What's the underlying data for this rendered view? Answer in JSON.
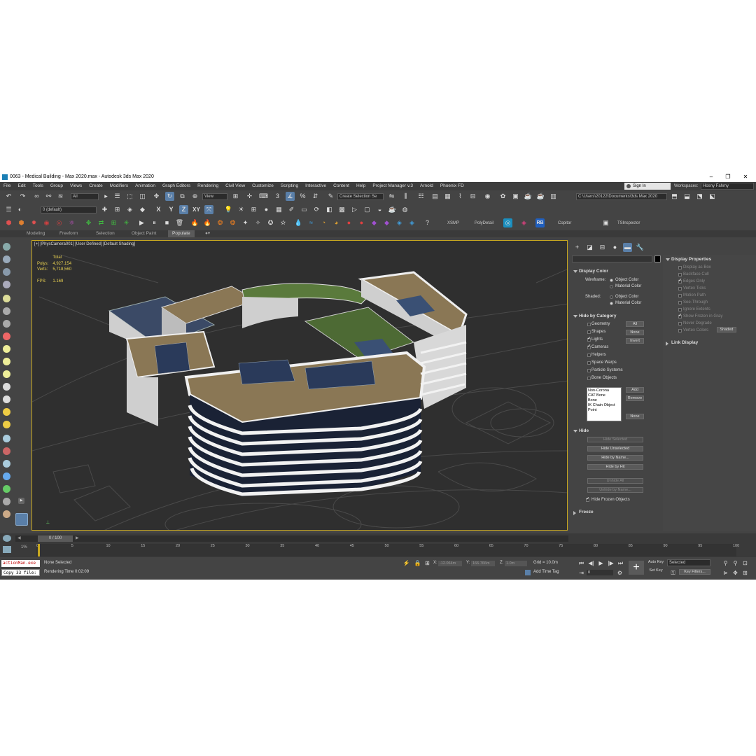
{
  "window": {
    "title": "0063 - Medical Building - Max 2020.max - Autodesk 3ds Max 2020",
    "minimize": "–",
    "maximize": "❐",
    "close": "✕"
  },
  "menu": [
    "File",
    "Edit",
    "Tools",
    "Group",
    "Views",
    "Create",
    "Modifiers",
    "Animation",
    "Graph Editors",
    "Rendering",
    "Civil View",
    "Customize",
    "Scripting",
    "Interactive",
    "Content",
    "Help",
    "Project Manager v.3",
    "Arnold",
    "Phoenix FD"
  ],
  "account": {
    "sign_in": "Sign In",
    "workspaces_label": "Workspaces:",
    "workspace": "Hosny Fahmy"
  },
  "toolbar": {
    "filter": "All",
    "ref_coord": "View",
    "selection_set": "Create Selection Se",
    "path": "C:\\Users\\20122\\Documents\\3ds Max 2020",
    "layer": "0 (default)",
    "xsmp": "XSMP",
    "polydetail": "PolyDetail",
    "copitor": "Copitor",
    "tsinspector": "TSInspector",
    "rb": "RB",
    "axis_x": "X",
    "axis_y": "Y",
    "axis_z": "Z",
    "axis_xy": "XY"
  },
  "ribbon": [
    "Modeling",
    "Freeform",
    "Selection",
    "Object Paint",
    "Populate"
  ],
  "viewport": {
    "label": "[+] [PhysCamera001] [User Defined] [Default Shading]",
    "stats_total": "Total",
    "polys_label": "Polys:",
    "polys": "4,927,154",
    "verts_label": "Verts:",
    "verts": "5,718,560",
    "fps_label": "FPS:",
    "fps": "1.169"
  },
  "command_panel": {
    "display_color": {
      "title": "Display Color",
      "wireframe_label": "Wireframe:",
      "shaded_label": "Shaded:",
      "object_color": "Object Color",
      "material_color": "Material Color"
    },
    "hide_by_category": {
      "title": "Hide by Category",
      "items": [
        {
          "label": "Geometry",
          "checked": false
        },
        {
          "label": "Shapes",
          "checked": false
        },
        {
          "label": "Lights",
          "checked": true
        },
        {
          "label": "Cameras",
          "checked": true
        },
        {
          "label": "Helpers",
          "checked": false
        },
        {
          "label": "Space Warps",
          "checked": false
        },
        {
          "label": "Particle Systems",
          "checked": false
        },
        {
          "label": "Bone Objects",
          "checked": false
        }
      ],
      "btn_all": "All",
      "btn_none": "None",
      "btn_invert": "Invert",
      "list": [
        "Non-Corona",
        "CAT Bone",
        "Bone",
        "IK Chain Object",
        "Point"
      ],
      "btn_add": "Add",
      "btn_remove": "Remove",
      "btn_none2": "None"
    },
    "hide": {
      "title": "Hide",
      "buttons": [
        "Hide Selected",
        "Hide Unselected",
        "Hide by Name...",
        "Hide by Hit",
        "Unhide All",
        "Unhide by Name..."
      ],
      "hide_frozen": "Hide Frozen Objects"
    },
    "freeze": {
      "title": "Freeze"
    }
  },
  "display_properties": {
    "title": "Display Properties",
    "items": [
      {
        "label": "Display as Box",
        "checked": false
      },
      {
        "label": "Backface Cull",
        "checked": false
      },
      {
        "label": "Edges Only",
        "checked": true
      },
      {
        "label": "Vertex Ticks",
        "checked": false
      },
      {
        "label": "Motion Path",
        "checked": false
      },
      {
        "label": "See-Through",
        "checked": false
      },
      {
        "label": "Ignore Extents",
        "checked": false
      },
      {
        "label": "Show Frozen in Gray",
        "checked": true
      },
      {
        "label": "Never Degrade",
        "checked": false
      },
      {
        "label": "Vertex Colors",
        "checked": false
      }
    ],
    "shaded_btn": "Shaded",
    "link_display": "Link Display"
  },
  "timeline": {
    "frame": "0 / 100",
    "ticks": [
      "0",
      "5",
      "10",
      "15",
      "20",
      "25",
      "30",
      "35",
      "40",
      "45",
      "50",
      "55",
      "60",
      "65",
      "70",
      "75",
      "80",
      "85",
      "90",
      "95",
      "100"
    ]
  },
  "status": {
    "maxscript_1": "actionMan.exe",
    "maxscript_2": "Copy 33 file:",
    "selection": "None Selected",
    "render_time": "Rendering Time  0:02:09",
    "x_label": "X:",
    "x": "-12.064m",
    "y_label": "Y:",
    "y": "166.766m",
    "z_label": "Z:",
    "z": "1.0m",
    "grid": "Grid = 10.0m",
    "add_time_tag": "Add Time Tag",
    "auto_key": "Auto Key",
    "set_key": "Set Key",
    "selected": "Selected",
    "key_filters": "Key Filters...",
    "frame_field": "0"
  }
}
